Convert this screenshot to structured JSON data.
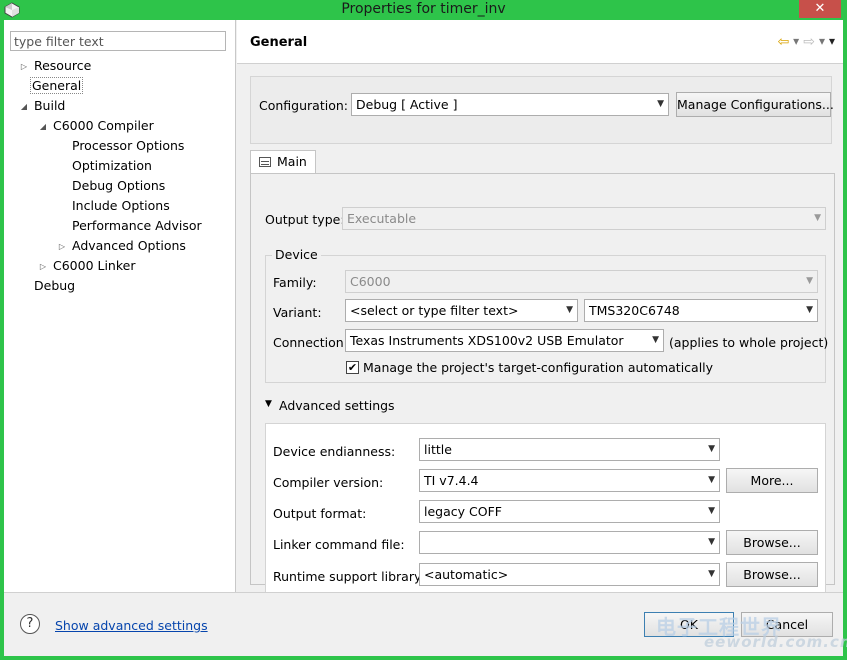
{
  "window": {
    "title": "Properties for timer_inv",
    "close_glyph": "✕"
  },
  "tree": {
    "filter_placeholder": "type filter text",
    "items": [
      {
        "label": "Resource",
        "twisty": "▷"
      },
      {
        "label": "General",
        "twisty": ""
      },
      {
        "label": "Build",
        "twisty": "◢"
      },
      {
        "label": "C6000 Compiler",
        "twisty": "◢"
      },
      {
        "label": "Processor Options",
        "twisty": ""
      },
      {
        "label": "Optimization",
        "twisty": ""
      },
      {
        "label": "Debug Options",
        "twisty": ""
      },
      {
        "label": "Include Options",
        "twisty": ""
      },
      {
        "label": "Performance Advisor",
        "twisty": ""
      },
      {
        "label": "Advanced Options",
        "twisty": "▷"
      },
      {
        "label": "C6000 Linker",
        "twisty": "▷"
      },
      {
        "label": "Debug",
        "twisty": ""
      }
    ],
    "selected": "General"
  },
  "header": {
    "title": "General",
    "nav": {
      "back": "⇦",
      "back_menu": "▾",
      "forward": "⇨",
      "forward_menu": "▾",
      "view_menu": "▾"
    }
  },
  "configuration": {
    "label": "Configuration:",
    "value": "Debug   [ Active ]",
    "manage_button": "Manage Configurations..."
  },
  "tab": {
    "label": "Main"
  },
  "main": {
    "output_type_label": "Output type:",
    "output_type_value": "Executable",
    "device": {
      "group_title": "Device",
      "family_label": "Family:",
      "family_value": "C6000",
      "variant_label": "Variant:",
      "variant_filter": "<select or type filter text>",
      "variant_value": "TMS320C6748",
      "connection_label": "Connection:",
      "connection_value": "Texas Instruments XDS100v2 USB Emulator",
      "connection_note": "(applies to whole project)",
      "manage_checkbox_label": "Manage the project's target-configuration automatically",
      "manage_checked": true
    },
    "advanced": {
      "toggle_glyph": "▼",
      "title": "Advanced settings",
      "endianness_label": "Device endianness:",
      "endianness_value": "little",
      "compiler_label": "Compiler version:",
      "compiler_value": "TI v7.4.4",
      "more_button": "More...",
      "output_format_label": "Output format:",
      "output_format_value": "legacy COFF",
      "linker_cmd_label": "Linker command file:",
      "linker_cmd_value": "",
      "browse_button_1": "Browse...",
      "rts_label": "Runtime support library:",
      "rts_value": "<automatic>",
      "browse_button_2": "Browse..."
    }
  },
  "footer": {
    "help_glyph": "?",
    "advanced_link": "Show advanced settings",
    "ok_button": "OK",
    "cancel_button": "Cancel"
  },
  "watermark": {
    "text_top": "电子工程世界",
    "text_bottom": "eeworld.com.cn"
  },
  "colors": {
    "titlebar": "#2ec44a",
    "link": "#0645ad",
    "close": "#c7504a"
  }
}
